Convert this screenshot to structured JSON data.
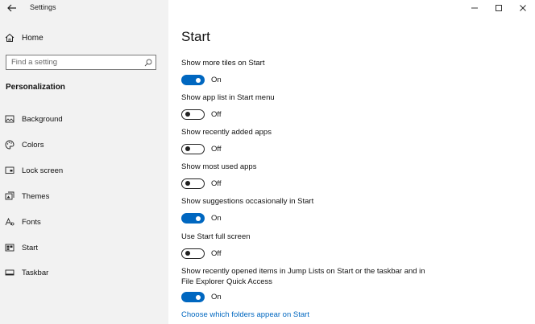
{
  "window": {
    "title": "Settings"
  },
  "sidebar": {
    "home_label": "Home",
    "search_placeholder": "Find a setting",
    "section_title": "Personalization",
    "items": [
      {
        "label": "Background",
        "icon": "picture-icon"
      },
      {
        "label": "Colors",
        "icon": "palette-icon"
      },
      {
        "label": "Lock screen",
        "icon": "lock-screen-icon"
      },
      {
        "label": "Themes",
        "icon": "themes-icon"
      },
      {
        "label": "Fonts",
        "icon": "fonts-icon"
      },
      {
        "label": "Start",
        "icon": "start-icon"
      },
      {
        "label": "Taskbar",
        "icon": "taskbar-icon"
      }
    ]
  },
  "main": {
    "page_title": "Start",
    "settings": [
      {
        "label": "Show more tiles on Start",
        "state": "On",
        "on": true
      },
      {
        "label": "Show app list in Start menu",
        "state": "Off",
        "on": false
      },
      {
        "label": "Show recently added apps",
        "state": "Off",
        "on": false
      },
      {
        "label": "Show most used apps",
        "state": "Off",
        "on": false
      },
      {
        "label": "Show suggestions occasionally in Start",
        "state": "On",
        "on": true
      },
      {
        "label": "Use Start full screen",
        "state": "Off",
        "on": false
      },
      {
        "label_line1": "Show recently opened items in Jump Lists on Start or the taskbar and in",
        "label_line2": "File Explorer Quick Access",
        "state": "On",
        "on": true
      }
    ],
    "link_text": "Choose which folders appear on Start"
  },
  "colors": {
    "accent": "#0067c0",
    "sidebar_bg": "#f2f2f2"
  }
}
